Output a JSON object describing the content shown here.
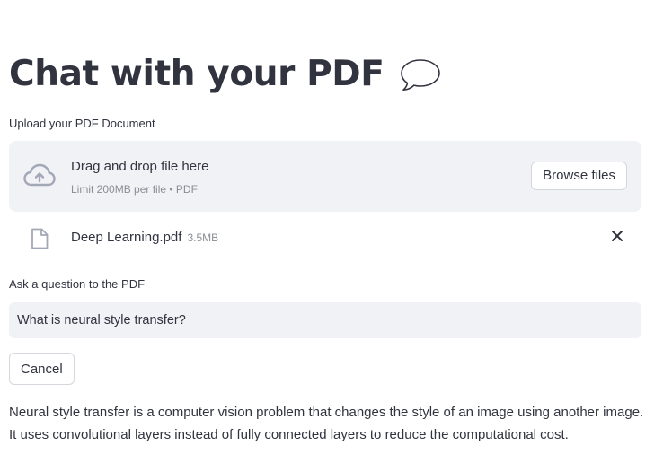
{
  "header": {
    "title": "Chat with your PDF",
    "title_icon": "speech-bubble-icon"
  },
  "uploader": {
    "label": "Upload your PDF Document",
    "dropzone_text": "Drag and drop file here",
    "dropzone_hint": "Limit 200MB per file • PDF",
    "browse_label": "Browse files",
    "icon": "cloud-upload-icon"
  },
  "uploaded_file": {
    "name": "Deep Learning.pdf",
    "size": "3.5MB",
    "icon": "file-icon",
    "remove_icon": "close-icon"
  },
  "question": {
    "label": "Ask a question to the PDF",
    "value": "What is neural style transfer?"
  },
  "actions": {
    "cancel_label": "Cancel"
  },
  "answer": {
    "line1": "Neural style transfer is a computer vision problem that changes the style of an image using another image.",
    "line2": "It uses convolutional layers instead of fully connected layers to reduce the computational cost."
  },
  "colors": {
    "text": "#31333f",
    "muted": "#8b8d96",
    "surface": "#f0f2f6",
    "icon": "#a3a8b8"
  }
}
